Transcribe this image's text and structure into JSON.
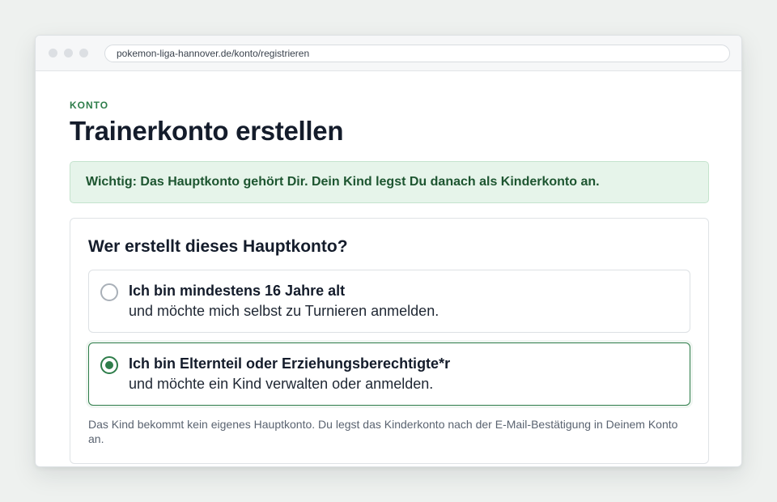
{
  "browser": {
    "url": "pokemon-liga-hannover.de/konto/registrieren"
  },
  "page": {
    "eyebrow": "KONTO",
    "title": "Trainerkonto erstellen",
    "notice": "Wichtig: Das Hauptkonto gehört Dir. Dein Kind legst Du danach als Kinderkonto an."
  },
  "card": {
    "title": "Wer erstellt dieses Hauptkonto?",
    "options": [
      {
        "title": "Ich bin mindestens 16 Jahre alt",
        "subtitle": "und möchte mich selbst zu Turnieren anmelden.",
        "selected": false
      },
      {
        "title": "Ich bin Elternteil oder Erziehungsberechtigte*r",
        "subtitle": "und möchte ein Kind verwalten oder anmelden.",
        "selected": true
      }
    ],
    "hint": "Das Kind bekommt kein eigenes Hauptkonto. Du legst das Kinderkonto nach der E-Mail-Bestätigung in Deinem Konto an."
  },
  "colors": {
    "accent": "#2e7d4a",
    "notice_bg": "#e6f4ea",
    "text": "#141c2b"
  }
}
